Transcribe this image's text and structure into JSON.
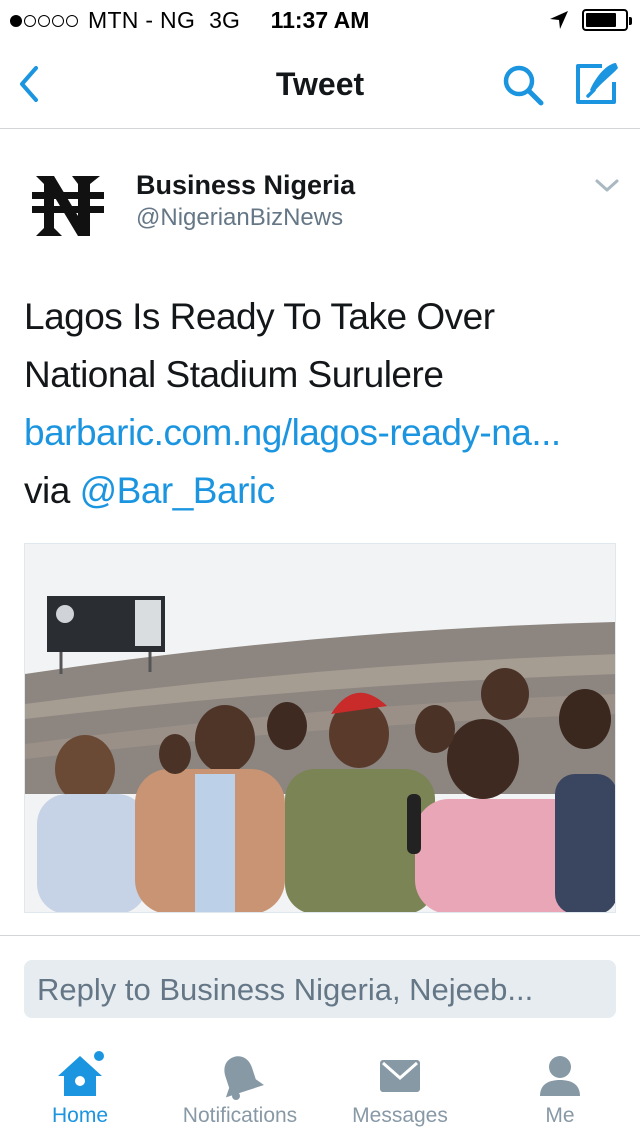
{
  "status_bar": {
    "carrier": "MTN - NG",
    "network": "3G",
    "time": "11:37 AM",
    "signal_bars": 1,
    "signal_total": 5,
    "battery_level": 0.8
  },
  "nav": {
    "title": "Tweet",
    "back_icon": "chevron-left-icon",
    "search_icon": "search-icon",
    "compose_icon": "compose-icon"
  },
  "tweet": {
    "author_name": "Business Nigeria",
    "author_handle": "@NigerianBizNews",
    "text_lines": [
      "Lagos Is Ready To Take Over",
      "National Stadium Surulere"
    ],
    "link_text": "barbaric.com.ng/lagos-ready-na...",
    "via_label": "via",
    "via_handle": "@Bar_Baric"
  },
  "reply": {
    "placeholder": "Reply to Business Nigeria, Nejeeb..."
  },
  "tabs": [
    {
      "label": "Home",
      "icon": "home-icon",
      "active": true
    },
    {
      "label": "Notifications",
      "icon": "bell-icon",
      "active": false
    },
    {
      "label": "Messages",
      "icon": "envelope-icon",
      "active": false
    },
    {
      "label": "Me",
      "icon": "person-icon",
      "active": false
    }
  ],
  "colors": {
    "accent": "#1b95e0",
    "text": "#14171a",
    "secondary": "#657786",
    "tab_inactive": "#8899a6"
  }
}
